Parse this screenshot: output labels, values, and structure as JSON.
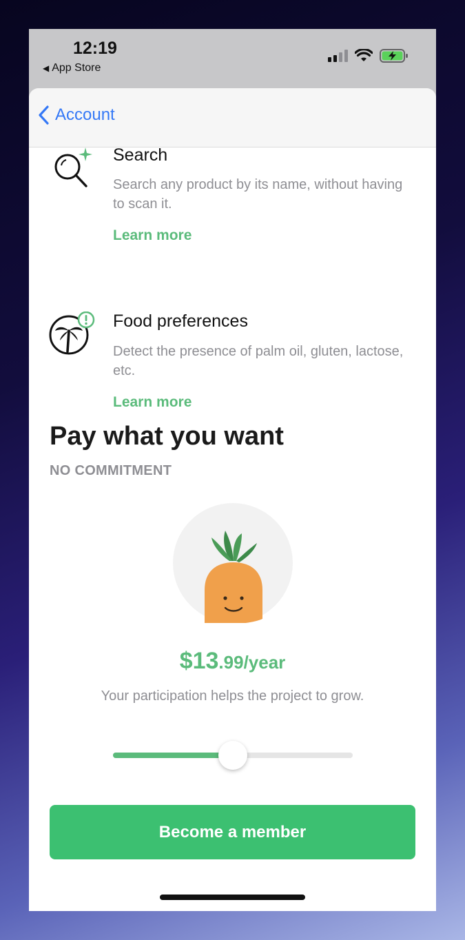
{
  "status_bar": {
    "time": "12:19",
    "back_app": "App Store"
  },
  "nav": {
    "back_label": "Account"
  },
  "features": [
    {
      "title": "Search",
      "description": "Search any product by its name, without having to scan it.",
      "link": "Learn more",
      "icon": "search-sparkle-icon"
    },
    {
      "title": "Food preferences",
      "description": "Detect the presence of palm oil, gluten, lactose, etc.",
      "link": "Learn more",
      "icon": "palm-tree-alert-icon"
    }
  ],
  "pricing": {
    "title": "Pay what you want",
    "subtitle": "NO COMMITMENT",
    "price_main": "$13",
    "price_rest": ".99/year",
    "tagline": "Your participation helps the project to grow.",
    "slider_fraction": 0.5
  },
  "cta": {
    "label": "Become a member"
  },
  "colors": {
    "accent_green": "#5bbb7b",
    "button_green": "#3cc071",
    "link_blue": "#3478f6"
  }
}
